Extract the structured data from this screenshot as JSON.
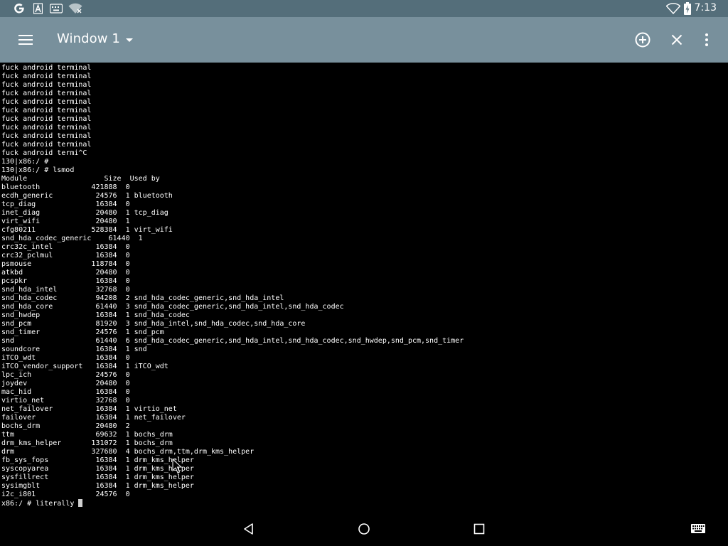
{
  "status_bar": {
    "time": "7:13",
    "left_icons": [
      "google-icon",
      "font-a-icon",
      "keyboard-notification-icon",
      "wifi-off-icon"
    ],
    "right_icons": [
      "wifi-icon",
      "battery-charging-icon"
    ]
  },
  "app_bar": {
    "title": "Window 1",
    "icons": [
      "hamburger-menu-icon",
      "dropdown-arrow-icon",
      "add-window-icon",
      "close-icon",
      "overflow-menu-icon"
    ]
  },
  "terminal": {
    "lines": [
      "fuck android terminal",
      "fuck android terminal",
      "fuck android terminal",
      "fuck android terminal",
      "fuck android terminal",
      "fuck android terminal",
      "fuck android terminal",
      "fuck android terminal",
      "fuck android terminal",
      "fuck android terminal",
      "fuck android termi^C",
      "130|x86:/ #",
      "130|x86:/ # lsmod",
      "Module                  Size  Used by",
      "bluetooth            421888  0",
      "ecdh_generic          24576  1 bluetooth",
      "tcp_diag              16384  0",
      "inet_diag             20480  1 tcp_diag",
      "virt_wifi             20480  1",
      "cfg80211             528384  1 virt_wifi",
      "snd_hda_codec_generic    61440  1",
      "crc32c_intel          16384  0",
      "crc32_pclmul          16384  0",
      "psmouse              118784  0",
      "atkbd                 20480  0",
      "pcspkr                16384  0",
      "snd_hda_intel         32768  0",
      "snd_hda_codec         94208  2 snd_hda_codec_generic,snd_hda_intel",
      "snd_hda_core          61440  3 snd_hda_codec_generic,snd_hda_intel,snd_hda_codec",
      "snd_hwdep             16384  1 snd_hda_codec",
      "snd_pcm               81920  3 snd_hda_intel,snd_hda_codec,snd_hda_core",
      "snd_timer             24576  1 snd_pcm",
      "snd                   61440  6 snd_hda_codec_generic,snd_hda_intel,snd_hda_codec,snd_hwdep,snd_pcm,snd_timer",
      "soundcore             16384  1 snd",
      "iTCO_wdt              16384  0",
      "iTCO_vendor_support   16384  1 iTCO_wdt",
      "lpc_ich               24576  0",
      "joydev                20480  0",
      "mac_hid               16384  0",
      "virtio_net            32768  0",
      "net_failover          16384  1 virtio_net",
      "failover              16384  1 net_failover",
      "bochs_drm             20480  2",
      "ttm                   69632  1 bochs_drm",
      "drm_kms_helper       131072  1 bochs_drm",
      "drm                  327680  4 bochs_drm,ttm,drm_kms_helper",
      "fb_sys_fops           16384  1 drm_kms_helper",
      "syscopyarea           16384  1 drm_kms_helper",
      "sysfillrect           16384  1 drm_kms_helper",
      "sysimgblt             16384  1 drm_kms_helper",
      "i2c_i801              24576  0"
    ],
    "prompt": "x86:/ # literally "
  },
  "nav_bar": {
    "icons": [
      "back-icon",
      "home-icon",
      "recents-icon",
      "keyboard-icon"
    ]
  },
  "colors": {
    "status_bar": "#546e7a",
    "app_bar": "#78909c",
    "terminal_bg": "#000000",
    "terminal_fg": "#ffffff"
  }
}
